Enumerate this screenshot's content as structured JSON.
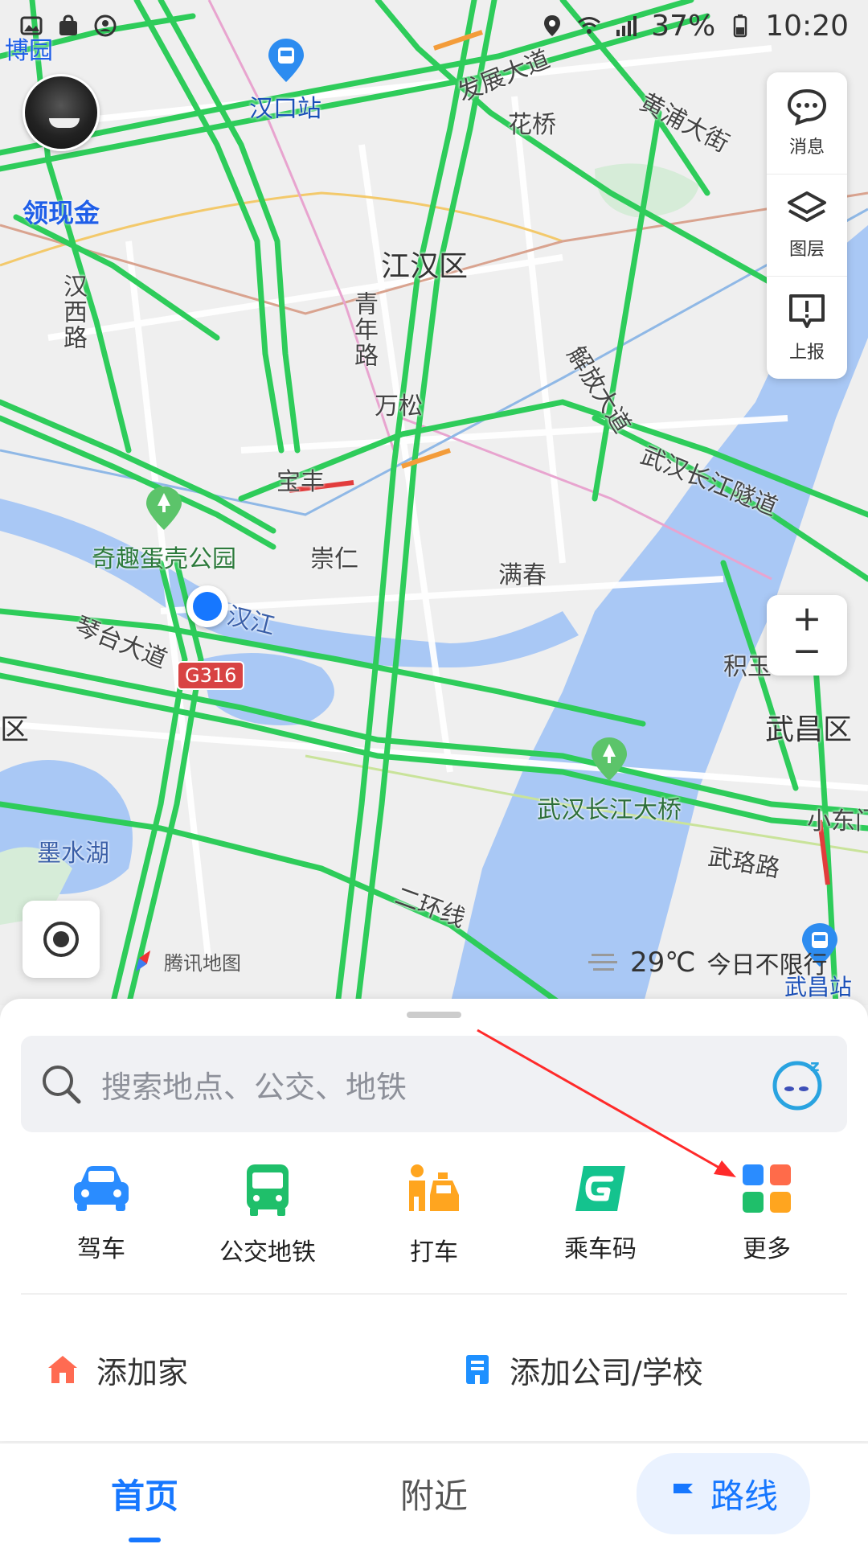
{
  "status_bar": {
    "left_text": "博园",
    "battery": "37%",
    "time": "10:20"
  },
  "promo_label": "领现金",
  "map_labels": {
    "hankou_station": "汉口站",
    "fazhan_ave": "发展大道",
    "huaqiao": "花桥",
    "huangpu_st": "黄浦大街",
    "jianghan_district": "江汉区",
    "hanxi_road": "汉西路",
    "qingnian_road": "青年路",
    "wansong": "万松",
    "jiefang_ave": "解放大道",
    "baofeng": "宝丰",
    "changjiang_tunnel": "武汉长江隧道",
    "qiqu_park": "奇趣蛋壳公园",
    "chongren": "崇仁",
    "manchun": "满春",
    "hanjiang": "汉江",
    "qintai_ave": "琴台大道",
    "g316": "G316",
    "jiyu": "积玉",
    "wuchang_district": "武昌区",
    "district_left": "区",
    "changjiang_bridge": "武汉长江大桥",
    "xiaodong": "小东门",
    "moshui_lake": "墨水湖",
    "wuluo_road": "武珞路",
    "second_ring": "二环线",
    "wuchang_station": "武昌站"
  },
  "tools": {
    "messages": "消息",
    "layers": "图层",
    "report": "上报"
  },
  "attribution": "腾讯地图",
  "weather": {
    "temperature": "29℃",
    "restriction": "今日不限行"
  },
  "search": {
    "placeholder": "搜索地点、公交、地铁"
  },
  "shortcuts": [
    {
      "label": "驾车",
      "icon": "car-icon",
      "color": "#2a8cff"
    },
    {
      "label": "公交地铁",
      "icon": "bus-icon",
      "color": "#1fbf6a"
    },
    {
      "label": "打车",
      "icon": "taxi-icon",
      "color": "#ffa51f"
    },
    {
      "label": "乘车码",
      "icon": "ride-code-icon",
      "color": "#14c38e"
    },
    {
      "label": "更多",
      "icon": "more-grid-icon",
      "color": "#ff6b4a"
    }
  ],
  "places": {
    "home": "添加家",
    "work": "添加公司/学校"
  },
  "nav": {
    "home": "首页",
    "nearby": "附近",
    "route": "路线"
  },
  "colors": {
    "accent": "#1677ff",
    "road_green": "#2ecc5a",
    "water": "#a9c8f5",
    "annotation": "#ff2a2a"
  }
}
